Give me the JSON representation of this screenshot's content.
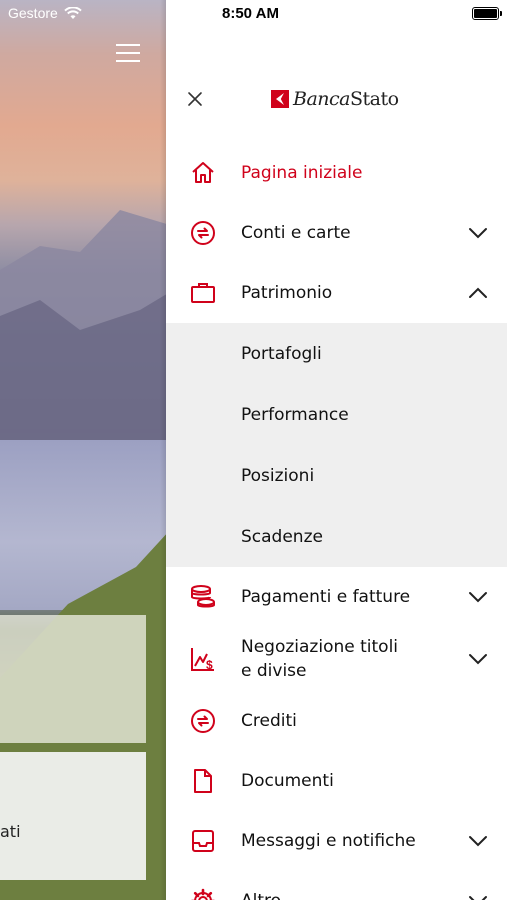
{
  "left_status": {
    "carrier": "Gestore"
  },
  "left_card": {
    "text": "ati"
  },
  "drawer": {
    "time": "8:50 AM",
    "logo": {
      "part1": "Banca",
      "part2": "Stato"
    }
  },
  "menu": {
    "home": "Pagina iniziale",
    "accounts": "Conti e carte",
    "wealth": "Patrimonio",
    "portfolios": "Portafogli",
    "performance": "Performance",
    "positions": "Posizioni",
    "maturities": "Scadenze",
    "payments": "Pagamenti e fatture",
    "trading_line1": "Negoziazione titoli",
    "trading_line2": "e divise",
    "credits": "Crediti",
    "documents": "Documenti",
    "messages": "Messaggi e notifiche",
    "other": "Altro"
  },
  "colors": {
    "accent": "#d0021b"
  }
}
